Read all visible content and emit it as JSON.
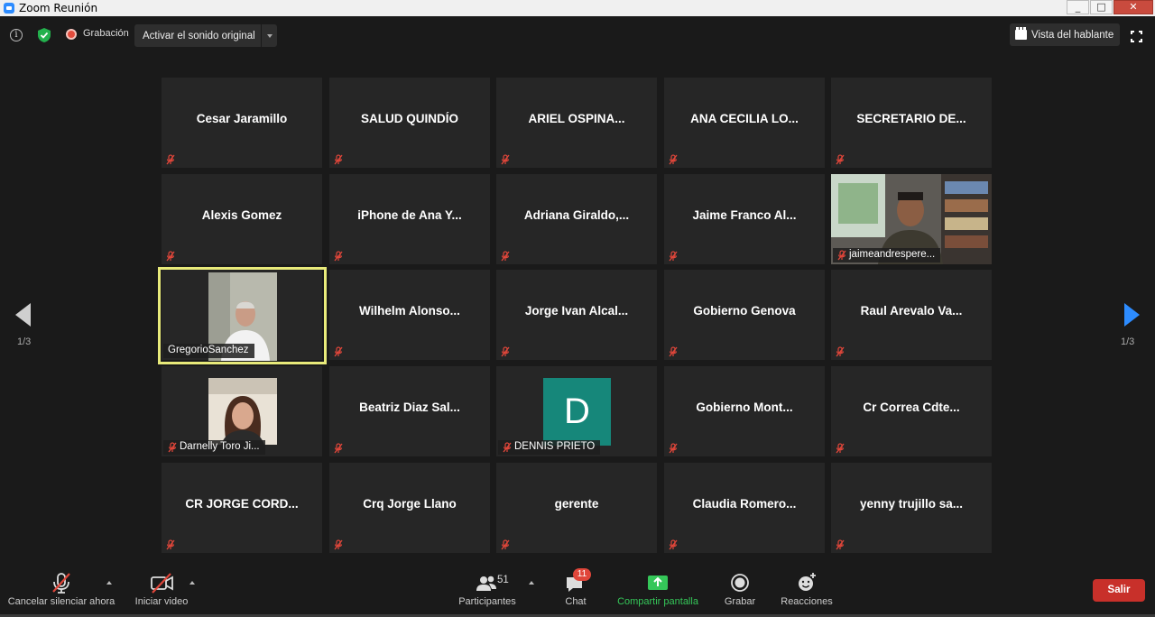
{
  "window": {
    "title": "Zoom Reunión",
    "minimize": "_",
    "maximize": "□",
    "close": "✕"
  },
  "topbar": {
    "info_glyph": "i",
    "recording_label": "Grabación",
    "audio_button_label": "Activar el sonido original",
    "speaker_view_label": "Vista del hablante"
  },
  "pages": {
    "left": "1/3",
    "right": "1/3"
  },
  "participants": [
    {
      "name": "Cesar Jaramillo",
      "muted": true
    },
    {
      "name": "SALUD QUINDÍO",
      "muted": true
    },
    {
      "name": "ARIEL  OSPINA...",
      "muted": true
    },
    {
      "name": "ANA CECILIA LO...",
      "muted": true
    },
    {
      "name": "SECRETARIO  DE...",
      "muted": true
    },
    {
      "name": "Alexis Gomez",
      "muted": true
    },
    {
      "name": "iPhone de Ana Y...",
      "muted": true
    },
    {
      "name": "Adriana  Giraldo,...",
      "muted": true
    },
    {
      "name": "Jaime Franco Al...",
      "muted": true
    },
    {
      "name": "jaimeandrespere...",
      "muted": true,
      "video": "man-bookshelf"
    },
    {
      "name": "GregorioSanchez",
      "muted": false,
      "video": "man-white-shirt",
      "active": true
    },
    {
      "name": "Wilhelm  Alonso...",
      "muted": true
    },
    {
      "name": "Jorge Ivan Alcal...",
      "muted": true
    },
    {
      "name": "Gobierno Genova",
      "muted": true
    },
    {
      "name": "Raul Arevalo Va...",
      "muted": true
    },
    {
      "name": "Darnelly Toro Ji...",
      "muted": true,
      "video": "woman-car"
    },
    {
      "name": "Beatriz Diaz Sal...",
      "muted": true
    },
    {
      "name": "DENNIS PRIETO",
      "muted": true,
      "avatar_letter": "D",
      "avatar_color": "#16877a"
    },
    {
      "name": "Gobierno  Mont...",
      "muted": true
    },
    {
      "name": "Cr Correa Cdte...",
      "muted": true
    },
    {
      "name": "CR JORGE CORD...",
      "muted": true
    },
    {
      "name": "Crq Jorge Llano",
      "muted": true
    },
    {
      "name": "gerente",
      "muted": true
    },
    {
      "name": "Claudia  Romero...",
      "muted": true
    },
    {
      "name": "yenny trujillo sa...",
      "muted": true
    }
  ],
  "toolbar": {
    "unmute_label": "Cancelar silenciar ahora",
    "video_label": "Iniciar video",
    "participants_label": "Participantes",
    "participants_count": "51",
    "chat_label": "Chat",
    "chat_badge": "11",
    "share_label": "Compartir pantalla",
    "record_label": "Grabar",
    "reactions_label": "Reacciones",
    "leave_label": "Salir"
  },
  "colors": {
    "accent_blue": "#2d8cff",
    "active_speaker": "#e8ea7a",
    "share_green": "#35c759",
    "leave_red": "#c8302a",
    "mute_red": "#e0463a"
  }
}
